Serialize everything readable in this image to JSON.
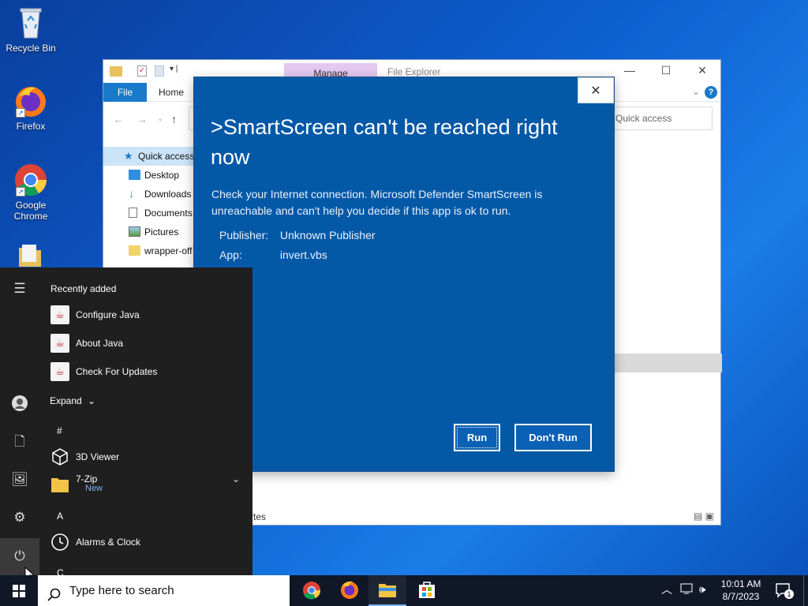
{
  "desktop": {
    "icons": [
      {
        "label": "Recycle Bin"
      },
      {
        "label": "Firefox"
      },
      {
        "label": "Google Chrome"
      }
    ]
  },
  "explorer": {
    "manage_tab": "Manage",
    "title": "File Explorer",
    "ribbon_file": "File",
    "ribbon_home": "Home",
    "search_placeholder": "Quick access",
    "nav_items": [
      {
        "label": "Quick access",
        "icon": "star-icon"
      },
      {
        "label": "Desktop",
        "icon": "desktop-folder-icon"
      },
      {
        "label": "Downloads",
        "icon": "download-icon"
      },
      {
        "label": "Documents",
        "icon": "documents-icon"
      },
      {
        "label": "Pictures",
        "icon": "pictures-icon"
      },
      {
        "label": "wrapper-off",
        "icon": "folder-icon"
      }
    ],
    "status_fragment": "rtes"
  },
  "smartscreen": {
    "title": ">SmartScreen can't be reached right now",
    "message": "Check your Internet connection. Microsoft Defender SmartScreen is unreachable and can't help you decide if this app is ok to run.",
    "publisher_label": "Publisher:",
    "publisher_value": "Unknown Publisher",
    "app_label": "App:",
    "app_value": "invert.vbs",
    "run_label": "Run",
    "dont_run_label": "Don't Run",
    "accent": "#0459a7"
  },
  "start_menu": {
    "recently_added": "Recently added",
    "recent": [
      {
        "label": "Configure Java"
      },
      {
        "label": "About Java"
      },
      {
        "label": "Check For Updates"
      }
    ],
    "expand_label": "Expand",
    "section_hash": "#",
    "apps": [
      {
        "label": "3D Viewer"
      },
      {
        "label": "7-Zip",
        "badge": "New"
      }
    ],
    "section_a": "A",
    "alarms": "Alarms & Clock",
    "section_c": "C"
  },
  "taskbar": {
    "search_placeholder": "Type here to search",
    "time": "10:01 AM",
    "date": "8/7/2023",
    "notification_count": "1"
  }
}
